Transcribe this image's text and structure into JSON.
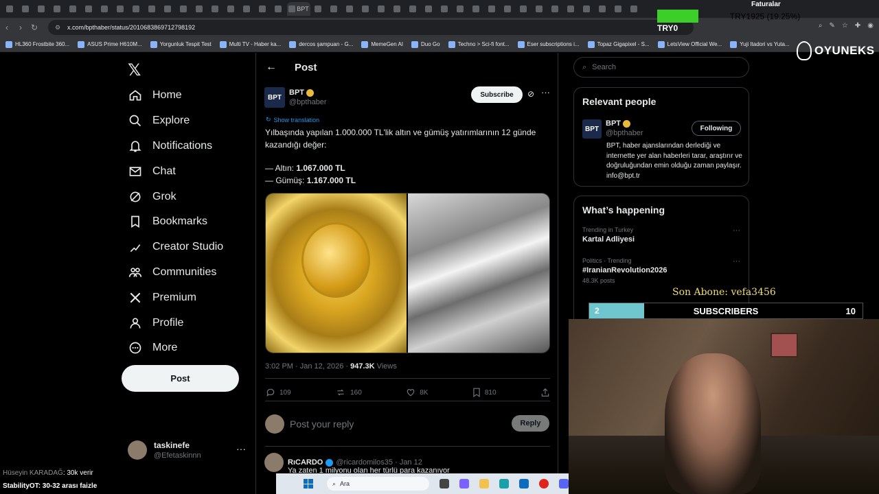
{
  "browser": {
    "url": "x.com/bpthaber/status/2010683869712798192",
    "tab_count": 40,
    "active_tab_label": "BPT",
    "bookmarks": [
      "HL360 Frostbite 360...",
      "ASUS Prime H610M...",
      "Yorgunluk Tespit Test",
      "Multi TV - Haber ka...",
      "dercos şampuan - G...",
      "MemeGen AI",
      "Duo Go",
      "Techno > Sci-fi font...",
      "Eser subscriptions i...",
      "Topaz Gigapixel - S...",
      "LetsView Official We...",
      "Yuji Itadori vs Yuta..."
    ]
  },
  "overlay": {
    "faturalar": "Faturalar",
    "stock_text": "TRY1925 (19.25%)",
    "stock_progress_percent": 19.25,
    "try0": "TRY0",
    "brand": "OYUNEKS",
    "son_abone": "Son Abone: vefa3456",
    "subs_current": "2",
    "subs_label": "SUBSCRIBERS",
    "subs_goal": "10",
    "subs_progress_fraction": 0.2,
    "chat": [
      {
        "user": "Hüseyin KARADAĞ",
        "message": ": 30k verir"
      },
      {
        "user": "StabilityOT",
        "message": ": 30-32 arası faizle"
      }
    ]
  },
  "nav": {
    "items": [
      {
        "label": "Home",
        "icon": "home-icon"
      },
      {
        "label": "Explore",
        "icon": "search-icon"
      },
      {
        "label": "Notifications",
        "icon": "bell-icon"
      },
      {
        "label": "Chat",
        "icon": "mail-icon"
      },
      {
        "label": "Grok",
        "icon": "grok-icon"
      },
      {
        "label": "Bookmarks",
        "icon": "bookmark-icon"
      },
      {
        "label": "Creator Studio",
        "icon": "lightning-icon"
      },
      {
        "label": "Communities",
        "icon": "people-icon"
      },
      {
        "label": "Premium",
        "icon": "x-icon"
      },
      {
        "label": "Profile",
        "icon": "person-icon"
      },
      {
        "label": "More",
        "icon": "more-circle-icon"
      }
    ],
    "post_button": "Post",
    "account": {
      "name": "taskinefe",
      "handle": "@Efetaskinnn"
    }
  },
  "post": {
    "header_title": "Post",
    "author_name": "BPT",
    "author_handle": "@bpthaber",
    "subscribe_label": "Subscribe",
    "show_translation": "Show translation",
    "text_line1": "Yılbaşında yapılan 1.000.000 TL'lik altın ve gümüş yatırımlarının 12 günde kazandığı değer:",
    "gold_prefix": "— Altın: ",
    "gold_value": "1.067.000 TL",
    "silver_prefix": "— Gümüş: ",
    "silver_value": "1.167.000 TL",
    "time": "3:02 PM · Jan 12, 2026 · ",
    "views_count": "947.3K",
    "views_label": " Views",
    "stats": {
      "replies": "109",
      "reposts": "160",
      "likes": "8K",
      "bookmarks": "810"
    },
    "reply_placeholder": "Post your reply",
    "reply_button": "Reply"
  },
  "reply_tweet": {
    "name": "RıCARDO",
    "handle": "@ricardomilos35 · Jan 12",
    "text": "Ya zaten 1 milyonu olan her türlü para kazanıyor"
  },
  "sidebar": {
    "search_placeholder": "Search",
    "relevant_title": "Relevant people",
    "person_name": "BPT",
    "person_handle": "@bpthaber",
    "following_label": "Following",
    "person_bio": "BPT, haber ajanslarından derlediği ve internette yer alan haberleri tarar, araştırır ve doğruluğundan emin olduğu zaman paylaşır. info@bpt.tr",
    "happening_title": "What’s happening",
    "trends": [
      {
        "context": "Trending in Turkey",
        "title": "Kartal Adliyesi",
        "count": ""
      },
      {
        "context": "Politics · Trending",
        "title": "#IranianRevolution2026",
        "count": "48.3K posts"
      }
    ]
  },
  "taskbar": {
    "search_label": "Ara"
  }
}
